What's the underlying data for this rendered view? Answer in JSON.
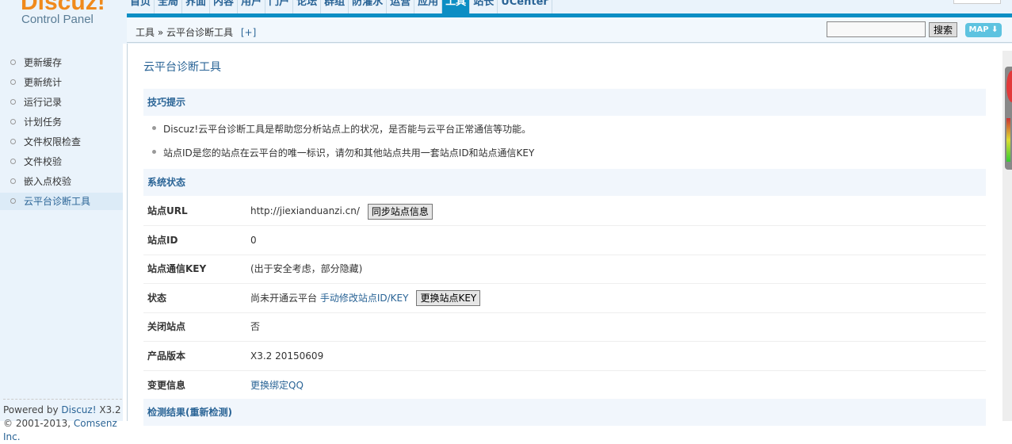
{
  "logo": {
    "brand": "Discuz!",
    "subtitle": "Control Panel"
  },
  "nav": [
    "首页",
    "全局",
    "界面",
    "内容",
    "用户",
    "门户",
    "论坛",
    "群组",
    "防灌水",
    "运营",
    "应用",
    "工具",
    "站长",
    "UCenter"
  ],
  "nav_active": "工具",
  "breadcrumb": {
    "root": "工具",
    "sep": "»",
    "current": "云平台诊断工具",
    "plus": "[+]"
  },
  "search": {
    "value": "",
    "button": "搜索",
    "map": "MAP ⬇"
  },
  "sidebar": [
    "更新缓存",
    "更新统计",
    "运行记录",
    "计划任务",
    "文件权限检查",
    "文件校验",
    "嵌入点校验",
    "云平台诊断工具"
  ],
  "sidebar_active": "云平台诊断工具",
  "footer": {
    "line1_pre": "Powered by ",
    "line1_link": "Discuz!",
    "line1_post": " X3.2",
    "line2_pre": "© 2001-2013, ",
    "line2_link": "Comsenz Inc."
  },
  "page_title": "云平台诊断工具",
  "tips_header": "技巧提示",
  "tips": [
    "Discuz!云平台诊断工具是帮助您分析站点上的状况，是否能与云平台正常通信等功能。",
    "站点ID是您的站点在云平台的唯一标识，请勿和其他站点共用一套站点ID和站点通信KEY"
  ],
  "status_header": "系统状态",
  "rows": [
    {
      "k": "站点URL",
      "v": "http://jiexianduanzi.cn/",
      "btn": "同步站点信息"
    },
    {
      "k": "站点ID",
      "v": "0"
    },
    {
      "k": "站点通信KEY",
      "v": "(出于安全考虑，部分隐藏)"
    },
    {
      "k": "状态",
      "v": "尚未开通云平台",
      "link": "手动修改站点ID/KEY",
      "btn": "更换站点KEY"
    },
    {
      "k": "关闭站点",
      "v": "否"
    },
    {
      "k": "产品版本",
      "v": "X3.2 20150609"
    },
    {
      "k": "变更信息",
      "link": "更换绑定QQ"
    }
  ],
  "result_header": "检测结果(重新检测)"
}
